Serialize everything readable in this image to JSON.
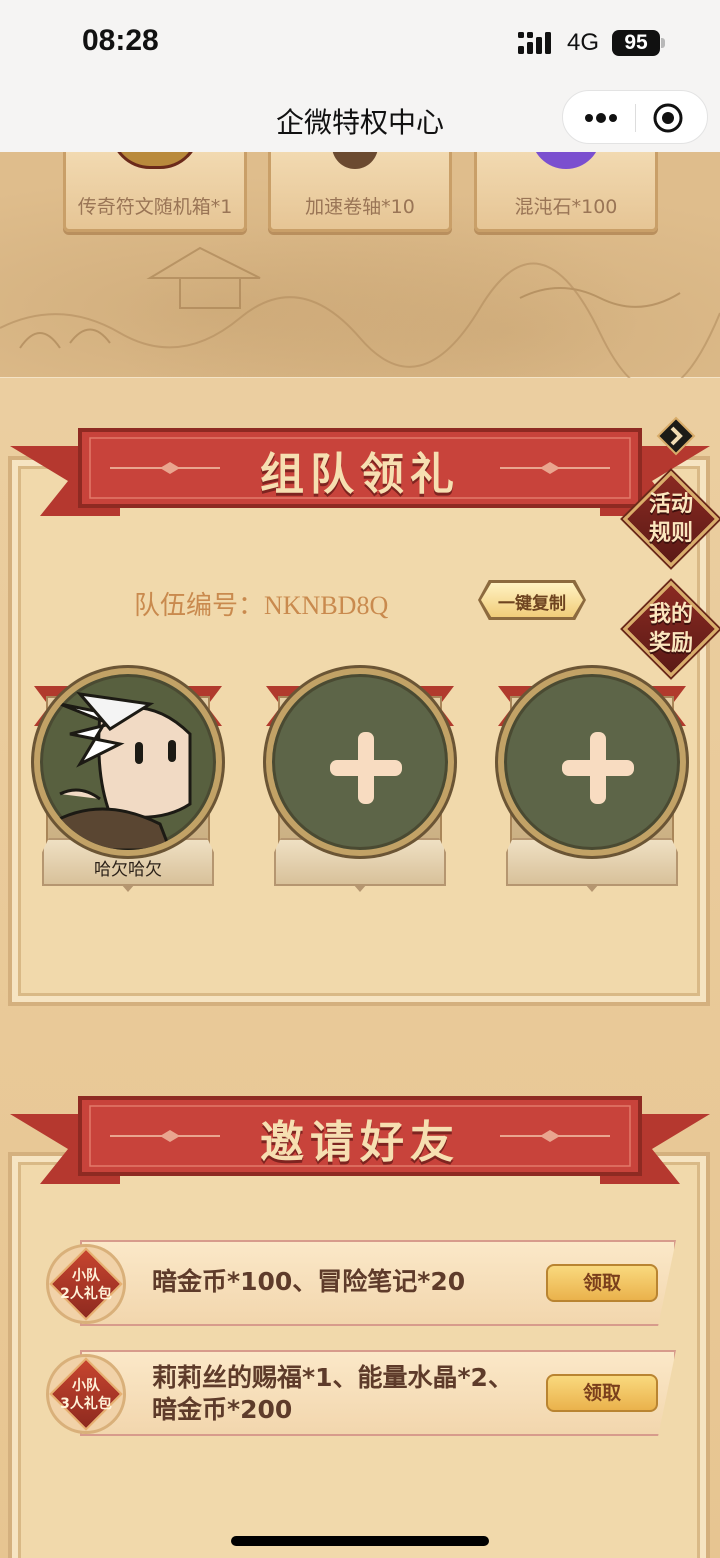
{
  "status_bar": {
    "time": "08:28",
    "network": "4G",
    "battery": "95"
  },
  "nav": {
    "title": "企微特权中心",
    "more_icon": "more-dots-icon",
    "close_icon": "target-close-icon"
  },
  "top_rewards": [
    {
      "label": "传奇符文随机箱*1",
      "icon": "treasure-box-icon",
      "color": "#b98a3c"
    },
    {
      "label": "加速卷轴*10",
      "icon": "scroll-icon",
      "color": "#6b4a30"
    },
    {
      "label": "混沌石*100",
      "icon": "chaos-stone-icon",
      "color": "#7b4fcf"
    }
  ],
  "team_section": {
    "title": "组队领礼",
    "rules_badge": "活动\n规则",
    "rewards_badge": "我的\n奖励",
    "team_number": "队伍编号：NKNBD8Q",
    "copy_button": "一键复制",
    "members": [
      {
        "name": "哈欠哈欠",
        "filled": true
      },
      {
        "name": "",
        "filled": false
      },
      {
        "name": "",
        "filled": false
      }
    ]
  },
  "invite_section": {
    "title": "邀请好友",
    "gifts": [
      {
        "badge": "小队\n2人礼包",
        "text": "暗金币*100、冒险笔记*20",
        "button": "领取"
      },
      {
        "badge": "小队\n3人礼包",
        "text": "莉莉丝的赐福*1、能量水晶*2、\n暗金币*200",
        "button": "领取"
      }
    ]
  },
  "colors": {
    "ribbon_red": "#c8433b",
    "parchment": "#f1d9ab",
    "avatar_bg": "#5d6548",
    "accent_gold": "#eab24c"
  }
}
